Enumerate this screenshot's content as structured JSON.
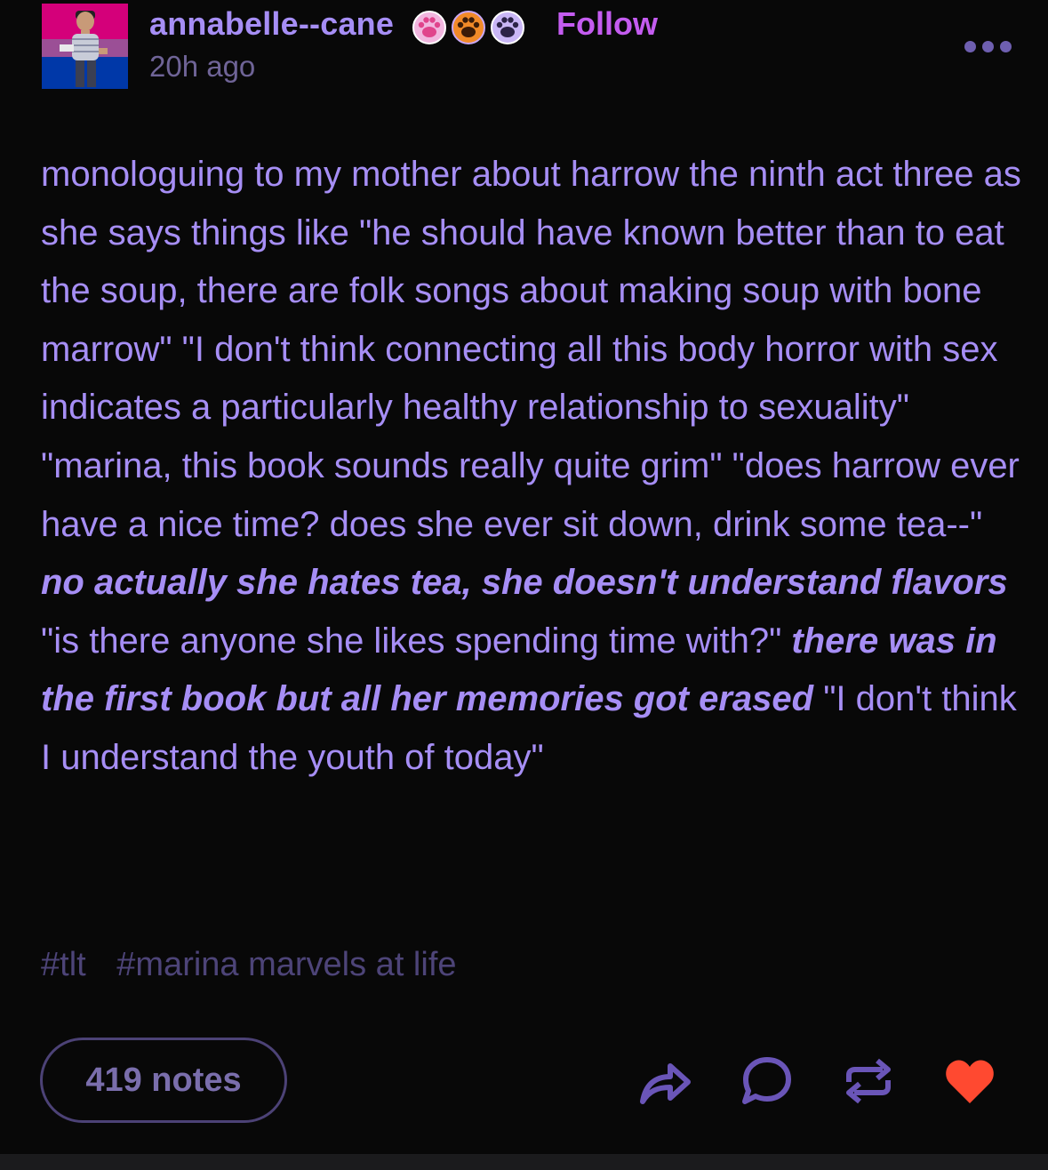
{
  "post": {
    "username": "annabelle--cane",
    "follow_label": "Follow",
    "timestamp": "20h ago",
    "badges": [
      "pink-paw-badge-icon",
      "orange-paw-badge-icon",
      "purple-paw-badge-icon"
    ],
    "body": {
      "text_1": "monologuing to my mother about harrow the ninth act three as she says things like \"he should have known better than to eat the soup, there are folk songs about making soup with bone marrow\" \"I don't think connecting all this body horror with sex indicates a particularly healthy relationship to sexuality\" \"marina, this book sounds really quite grim\" \"does harrow ever have a nice time? does she ever sit down, drink some tea--\" ",
      "italic_1": "no actually she hates tea, she doesn't understand flavors",
      "text_2": " \"is there anyone she likes spending time with?\" ",
      "italic_2": "there was in the first book but all her memories got erased",
      "text_3": " \"I don't think I understand the youth of today\""
    },
    "tags": [
      "#tlt",
      "#marina marvels at life"
    ],
    "notes_label": "419 notes"
  },
  "colors": {
    "background": "#080808",
    "text": "#a68ef5",
    "follow": "#c45cf0",
    "muted": "#6f6497",
    "like": "#ff4930"
  },
  "icons": [
    "more-options-icon",
    "share-icon",
    "reply-icon",
    "reblog-icon",
    "like-heart-icon"
  ]
}
